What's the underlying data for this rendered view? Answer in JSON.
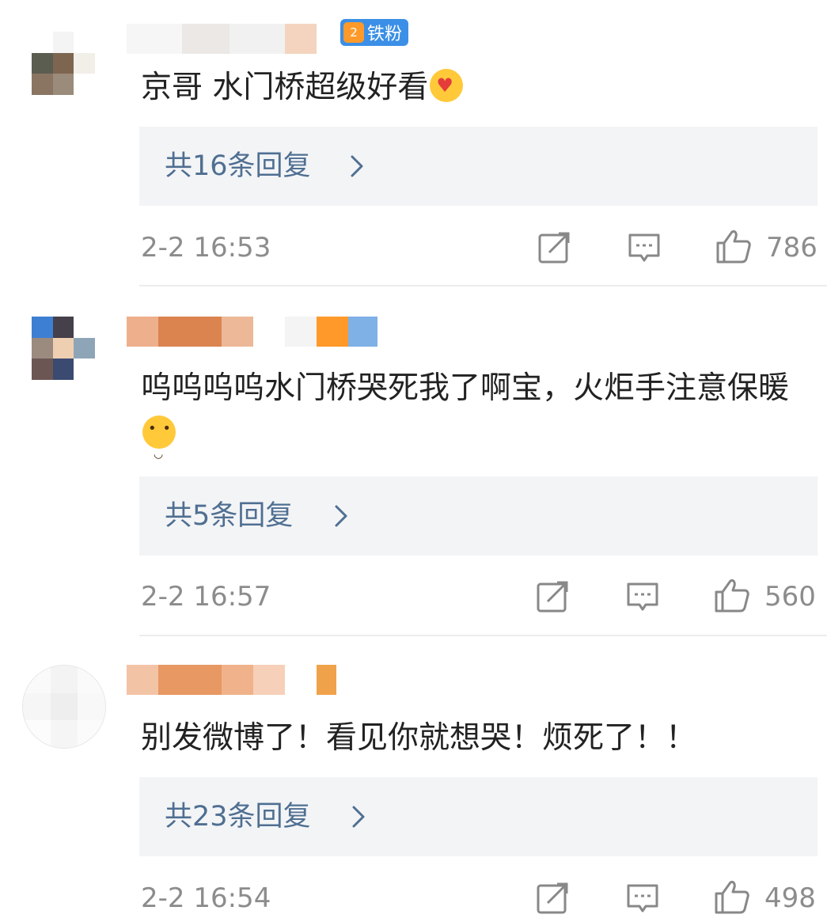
{
  "comments": [
    {
      "badge_label": "铁粉",
      "badge_level": "2",
      "text": "京哥  水门桥超级好看",
      "emoji": "heart-hug-emoji",
      "replies_label": "共16条回复",
      "time": "2-2 16:53",
      "likes": "786"
    },
    {
      "badge_label": "",
      "text": "呜呜呜呜水门桥哭死我了啊宝，火炬手注意保暖",
      "emoji": "pleading-face-emoji",
      "replies_label": "共5条回复",
      "time": "2-2 16:57",
      "likes": "560"
    },
    {
      "badge_label": "",
      "text": "别发微博了！看见你就想哭！烦死了！！",
      "replies_label": "共23条回复",
      "time": "2-2 16:54",
      "likes": "498"
    }
  ],
  "icons": {
    "repost": "repost-icon",
    "comment": "comment-icon",
    "like": "thumbs-up-icon",
    "chevron": "chevron-right-icon"
  },
  "colors": {
    "reply_link": "#4f6f92",
    "meta_gray": "#8c8c8c",
    "reply_bg": "#f3f4f6",
    "badge_blue": "#3b8fe6"
  }
}
